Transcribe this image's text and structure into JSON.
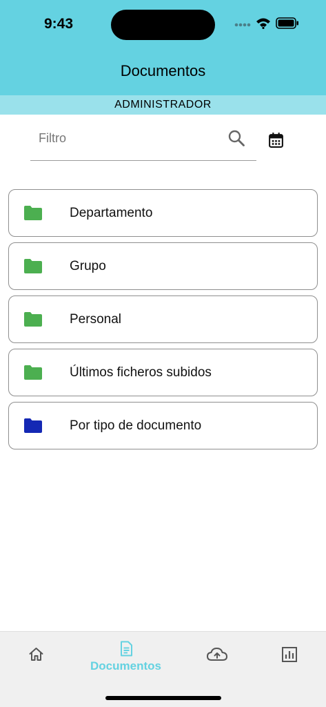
{
  "status_bar": {
    "time": "9:43"
  },
  "header": {
    "title": "Documentos",
    "role": "ADMINISTRADOR"
  },
  "filter": {
    "placeholder": "Filtro",
    "value": ""
  },
  "folders": [
    {
      "label": "Departamento",
      "color": "#4caf50"
    },
    {
      "label": "Grupo",
      "color": "#4caf50"
    },
    {
      "label": "Personal",
      "color": "#4caf50"
    },
    {
      "label": "Últimos ficheros subidos",
      "color": "#4caf50"
    },
    {
      "label": "Por tipo de documento",
      "color": "#1428b4"
    }
  ],
  "bottom_nav": {
    "active_label": "Documentos",
    "items": [
      "home-icon",
      "document-icon",
      "cloud-upload-icon",
      "chart-icon"
    ]
  },
  "colors": {
    "accent": "#64d2e1",
    "role_bar": "#9ae1eb",
    "folder_green": "#4caf50",
    "folder_blue": "#1428b4"
  }
}
